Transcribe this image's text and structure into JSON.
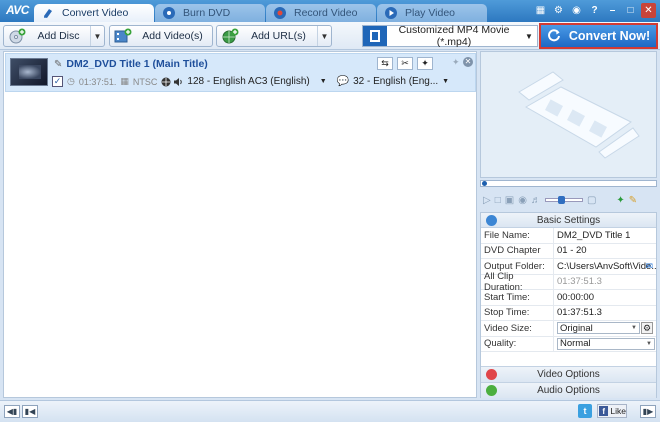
{
  "app": {
    "logo": "AVC"
  },
  "tabs": [
    {
      "label": "Convert Video",
      "active": true,
      "icon": "convert-video-icon"
    },
    {
      "label": "Burn DVD",
      "active": false,
      "icon": "burn-dvd-icon"
    },
    {
      "label": "Record Video",
      "active": false,
      "icon": "record-video-icon"
    },
    {
      "label": "Play Video",
      "active": false,
      "icon": "play-video-icon"
    }
  ],
  "toolbar": {
    "add_disc": "Add Disc",
    "add_videos": "Add Video(s)",
    "add_urls": "Add URL(s)",
    "profile": "Customized MP4 Movie (*.mp4)",
    "convert": "Convert Now!"
  },
  "file": {
    "title": "DM2_DVD Title 1 (Main Title)",
    "duration": "01:37:51.",
    "standard": "NTSC",
    "audio_track": "128 - English AC3 (English)",
    "subtitle": "32 - English (Eng...",
    "checked": true
  },
  "settings": {
    "header": "Basic Settings",
    "rows": [
      {
        "key": "File Name:",
        "value": "DM2_DVD Title 1"
      },
      {
        "key": "DVD Chapter",
        "value": "01  -  20"
      },
      {
        "key": "Output Folder:",
        "value": "C:\\Users\\AnvSoft\\Vide..."
      },
      {
        "key": "All Clip Duration:",
        "value": "01:37:51.3"
      },
      {
        "key": "Start Time:",
        "value": "00:00:00"
      },
      {
        "key": "Stop Time:",
        "value": "01:37:51.3"
      },
      {
        "key": "Video Size:",
        "value": "Original"
      },
      {
        "key": "Quality:",
        "value": "Normal"
      }
    ],
    "video_options": "Video Options",
    "audio_options": "Audio Options"
  },
  "status": {
    "like": "Like",
    "twitter": "t",
    "facebook": "f"
  },
  "colors": {
    "accent": "#2d78c0",
    "convert_border": "#d23a33",
    "selected_row": "#d6e8fa"
  }
}
